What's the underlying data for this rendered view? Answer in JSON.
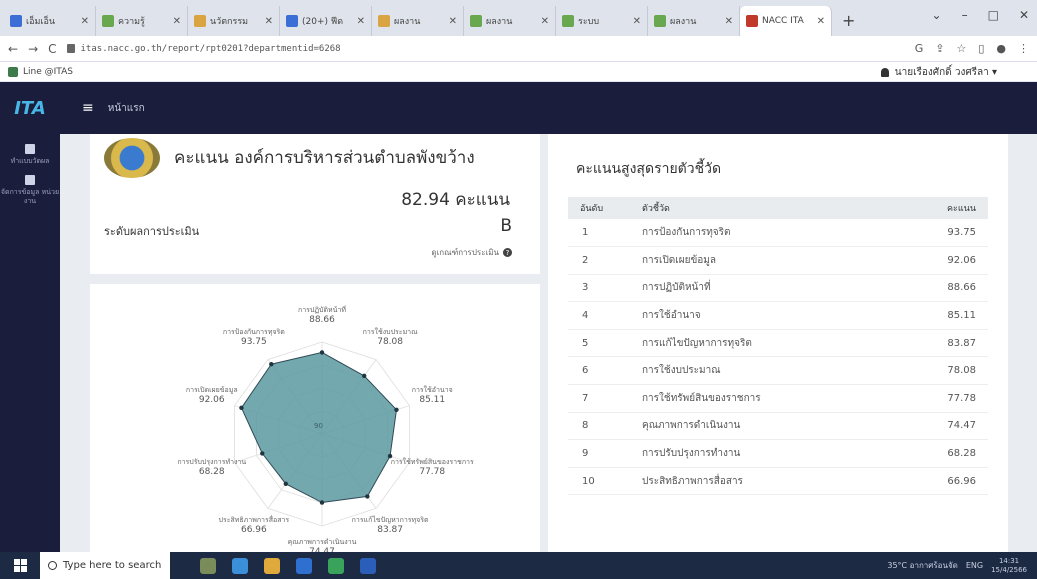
{
  "browser": {
    "tabs": [
      {
        "label": "เอ็มเอ็น",
        "fav": "g",
        "active": false
      },
      {
        "label": "ความรู้",
        "fav": "",
        "active": false
      },
      {
        "label": "นวัตกรรม",
        "fav": "y",
        "active": false
      },
      {
        "label": "(20+) ฟีด",
        "fav": "g",
        "active": false
      },
      {
        "label": "ผลงาน",
        "fav": "y",
        "active": false
      },
      {
        "label": "ผลงาน",
        "fav": "",
        "active": false
      },
      {
        "label": "ระบบ",
        "fav": "",
        "active": false
      },
      {
        "label": "ผลงาน",
        "fav": "",
        "active": false
      },
      {
        "label": "NACC ITA",
        "fav": "r",
        "active": true
      }
    ],
    "new_tab": "+",
    "window_controls": [
      "⌄",
      "–",
      "□",
      "✕"
    ],
    "url": "itas.nacc.go.th/report/rpt0201?departmentid=6268",
    "bookmark": "Line @ITAS",
    "user": "นายเรืองศักดิ์ วงศรีลา ▾"
  },
  "app": {
    "logo": "ITA",
    "menu_icon": "≡",
    "breadcrumb": "หน้าแรก"
  },
  "sidebar": {
    "items": [
      {
        "label": "ทำแบบวัดผล"
      },
      {
        "label": "จัดการข้อมูล หน่วยงาน"
      }
    ]
  },
  "summary": {
    "title": "คะแนน องค์การบริหารส่วนตำบลพังขว้าง",
    "score": "82.94 คะแนน",
    "level_label": "ระดับผลการประเมิน",
    "level_grade": "B",
    "criteria_link": "ดูเกณฑ์การประเมิน"
  },
  "radar": {
    "axes": [
      {
        "label": "การปฏิบัติหน้าที่",
        "value": 88.66
      },
      {
        "label": "การใช้งบประมาณ",
        "value": 78.08
      },
      {
        "label": "การใช้อำนาจ",
        "value": 85.11
      },
      {
        "label": "การใช้ทรัพย์สินของราชการ",
        "value": 77.78
      },
      {
        "label": "การแก้ไขปัญหาการทุจริต",
        "value": 83.87
      },
      {
        "label": "คุณภาพการดำเนินงาน",
        "value": 74.47
      },
      {
        "label": "ประสิทธิภาพการสื่อสาร",
        "value": 66.96
      },
      {
        "label": "การปรับปรุงการทำงาน",
        "value": 68.28
      },
      {
        "label": "การเปิดเผยข้อมูล",
        "value": 92.06
      },
      {
        "label": "การป้องกันการทุจริต",
        "value": 93.75
      }
    ],
    "center_label": "90"
  },
  "ranking": {
    "title": "คะแนนสูงสุดรายตัวชี้วัด",
    "columns": [
      "อันดับ",
      "ตัวชี้วัด",
      "คะแนน"
    ],
    "rows": [
      {
        "rank": "1",
        "name": "การป้องกันการทุจริต",
        "score": "93.75"
      },
      {
        "rank": "2",
        "name": "การเปิดเผยข้อมูล",
        "score": "92.06"
      },
      {
        "rank": "3",
        "name": "การปฏิบัติหน้าที่",
        "score": "88.66"
      },
      {
        "rank": "4",
        "name": "การใช้อำนาจ",
        "score": "85.11"
      },
      {
        "rank": "5",
        "name": "การแก้ไขปัญหาการทุจริต",
        "score": "83.87"
      },
      {
        "rank": "6",
        "name": "การใช้งบประมาณ",
        "score": "78.08"
      },
      {
        "rank": "7",
        "name": "การใช้ทรัพย์สินของราชการ",
        "score": "77.78"
      },
      {
        "rank": "8",
        "name": "คุณภาพการดำเนินงาน",
        "score": "74.47"
      },
      {
        "rank": "9",
        "name": "การปรับปรุงการทำงาน",
        "score": "68.28"
      },
      {
        "rank": "10",
        "name": "ประสิทธิภาพการสื่อสาร",
        "score": "66.96"
      }
    ]
  },
  "taskbar": {
    "search_placeholder": "Type here to search",
    "weather": "35°C อากาศร้อนจัด",
    "lang": "ENG",
    "time": "14:31",
    "date": "15/4/2566"
  },
  "colors": {
    "header_bg": "#1a1d3b",
    "radar_fill": "#5b9aa0",
    "accent": "#49b6e8"
  }
}
